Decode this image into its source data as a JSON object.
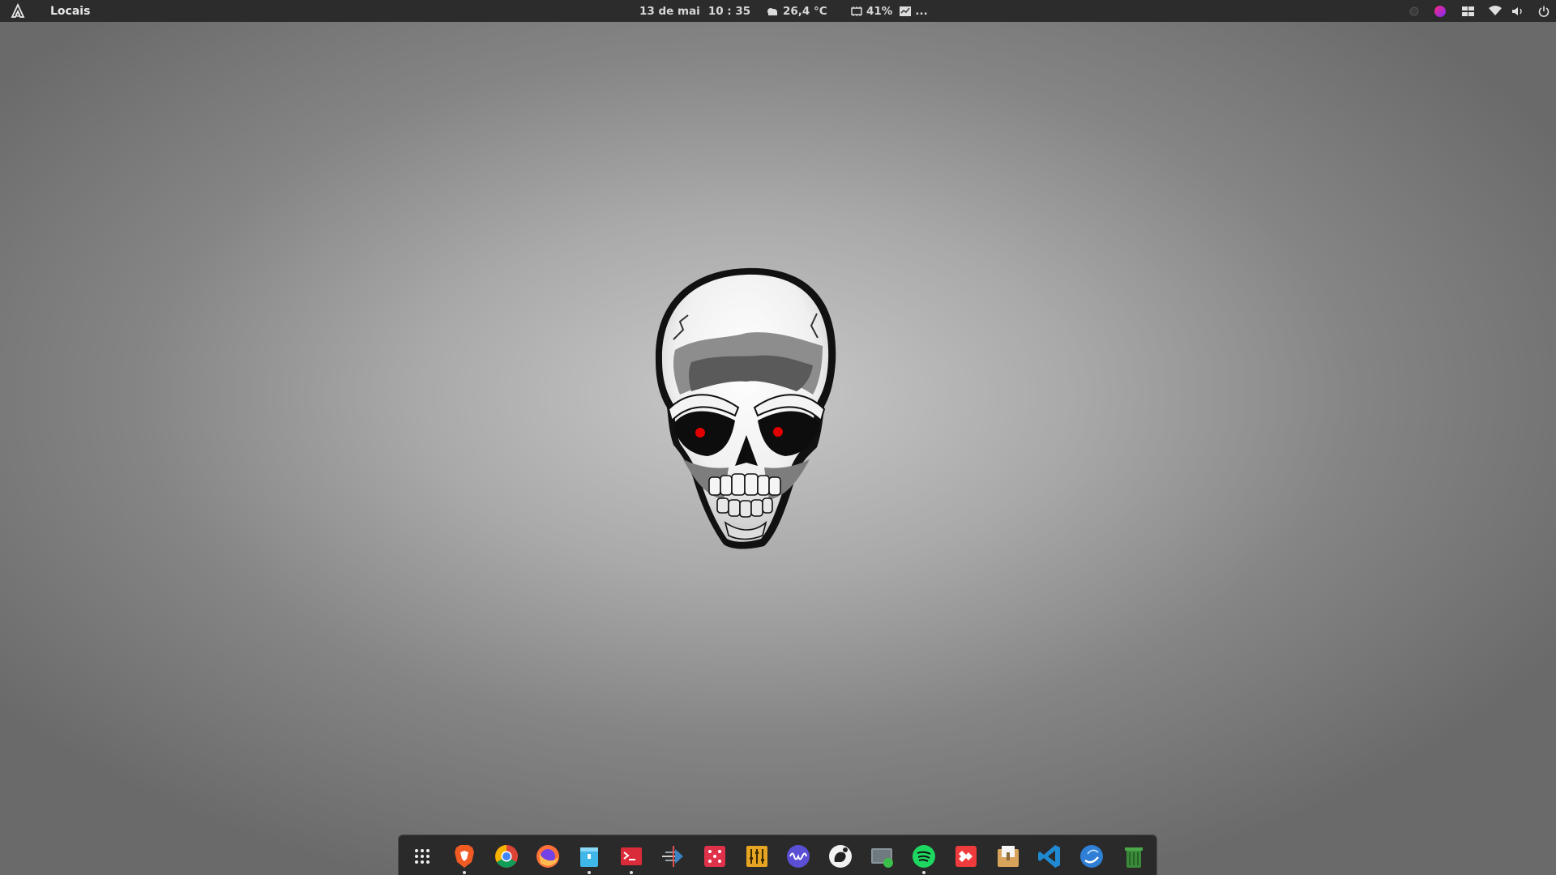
{
  "topbar": {
    "places_label": "Locais",
    "date": "13 de mai",
    "time": "10 : 35",
    "weather": "26,4 °C",
    "battery": "41%",
    "more": "..."
  },
  "dock": {
    "items": [
      {
        "name": "show-applications",
        "running": false
      },
      {
        "name": "brave-browser",
        "running": true
      },
      {
        "name": "google-chrome",
        "running": false
      },
      {
        "name": "firefox",
        "running": false
      },
      {
        "name": "files",
        "running": true
      },
      {
        "name": "terminal",
        "running": true
      },
      {
        "name": "deployer",
        "running": false
      },
      {
        "name": "app-grid-red",
        "running": false
      },
      {
        "name": "mixer",
        "running": false
      },
      {
        "name": "audio-waveform",
        "running": false
      },
      {
        "name": "gnome-logo-app",
        "running": false
      },
      {
        "name": "screen-cast",
        "running": false
      },
      {
        "name": "spotify",
        "running": true
      },
      {
        "name": "anydesk",
        "running": false
      },
      {
        "name": "archive-manager",
        "running": false
      },
      {
        "name": "vscode",
        "running": false
      },
      {
        "name": "arc-app",
        "running": false
      },
      {
        "name": "trash",
        "running": false
      }
    ]
  },
  "colors": {
    "topbar_bg": "#2c2c2c",
    "dock_bg": "#2a2a2a",
    "skull_eye": "#e00000"
  }
}
